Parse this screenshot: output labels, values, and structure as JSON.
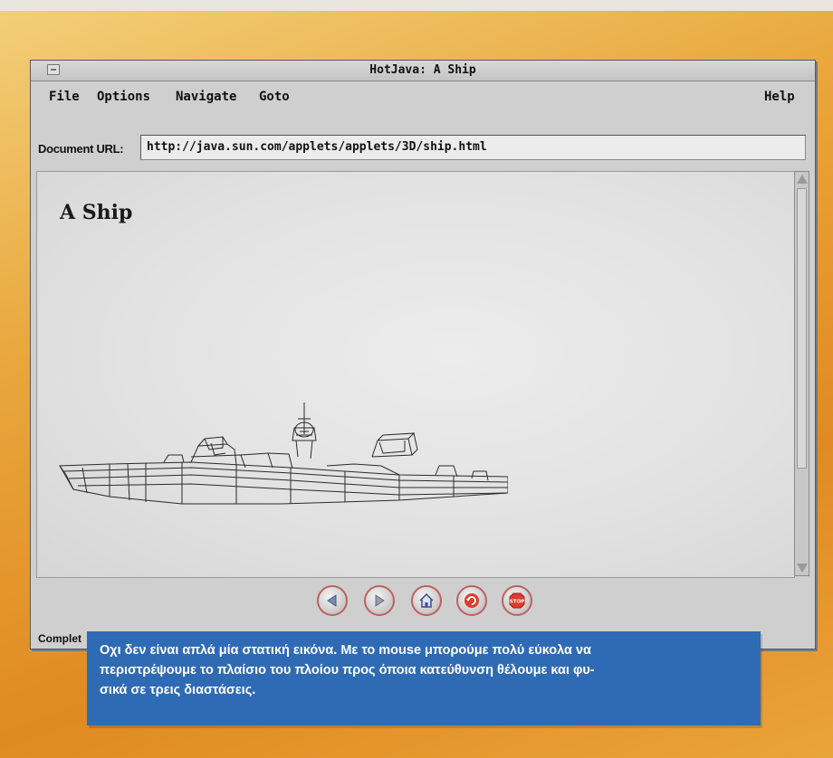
{
  "window": {
    "title": "HotJava: A Ship"
  },
  "menubar": {
    "file": "File",
    "options": "Options",
    "navigate": "Navigate",
    "goto": "Goto",
    "help": "Help"
  },
  "url_row": {
    "label": "Document URL:",
    "value": "http://java.sun.com/applets/applets/3D/ship.html"
  },
  "page": {
    "heading": "A Ship"
  },
  "toolbar": {
    "buttons": [
      {
        "icon": "back-arrow-icon"
      },
      {
        "icon": "forward-arrow-icon"
      },
      {
        "icon": "home-icon"
      },
      {
        "icon": "reload-icon"
      },
      {
        "icon": "stop-icon",
        "label": "STOP"
      }
    ]
  },
  "status": {
    "text": "Complet"
  },
  "caption": {
    "text": "Οχι δεν είναι απλά μία στατική εικόνα. Με το mouse μπορούμε  πολύ εύκολα να\nπεριστρέψουμε το πλαίσιο του πλοίου προς όποια κατεύθυνση θέλουμε και φυ-\nσικά σε τρεις διαστάσεις."
  },
  "colors": {
    "caption_bg": "#2f6bb4",
    "page_bg": "#e08a22",
    "button_ring": "#c06060"
  }
}
